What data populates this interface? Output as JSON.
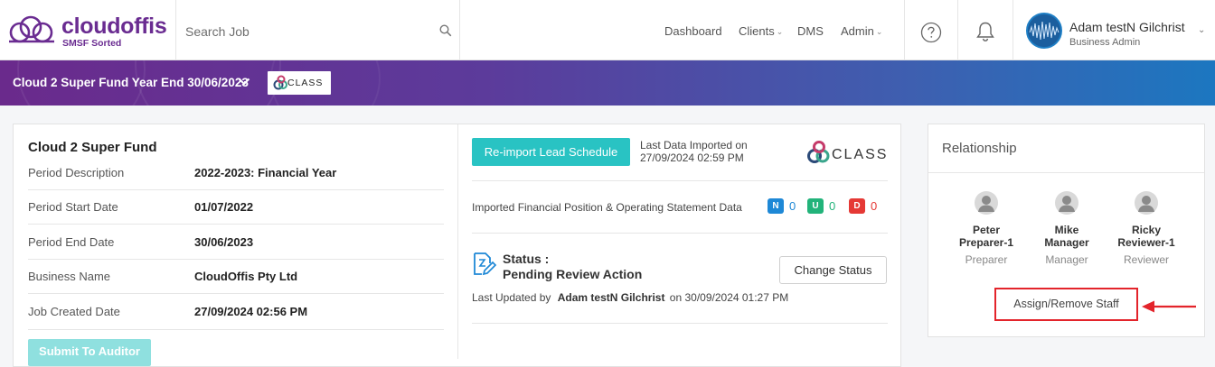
{
  "brand": {
    "name": "cloudoffis",
    "tagline": "SMSF Sorted",
    "color": "#6a2c91"
  },
  "search": {
    "placeholder": "Search Job",
    "icon": "search-icon"
  },
  "nav": {
    "dashboard": "Dashboard",
    "clients": "Clients",
    "dms": "DMS",
    "admin": "Admin"
  },
  "header_icons": {
    "help": "help-icon",
    "notifications": "bell-icon"
  },
  "user": {
    "name": "Adam testN Gilchrist",
    "role": "Business Admin"
  },
  "job_bar": {
    "title": "Cloud 2 Super Fund Year End 30/06/2023",
    "logo_text": "CLASS",
    "gradient": [
      "#6a2a8c",
      "#1c77c0"
    ]
  },
  "fund": {
    "name": "Cloud 2 Super Fund",
    "rows": [
      {
        "label": "Period Description",
        "value": "2022-2023: Financial Year"
      },
      {
        "label": "Period Start Date",
        "value": "01/07/2022"
      },
      {
        "label": "Period End Date",
        "value": "30/06/2023"
      },
      {
        "label": "Business Name",
        "value": "CloudOffis Pty Ltd"
      },
      {
        "label": "Job Created Date",
        "value": "27/09/2024 02:56 PM"
      }
    ],
    "submit_label": "Submit To Auditor"
  },
  "import": {
    "button_label": "Re-import Lead Schedule",
    "last_imported_label": "Last Data Imported on",
    "last_imported_value": "27/09/2024 02:59 PM",
    "logo_text": "CLASS",
    "data_label": "Imported Financial Position & Operating Statement Data",
    "badges": [
      {
        "letter": "N",
        "count": "0",
        "color": "#1e88d6"
      },
      {
        "letter": "U",
        "count": "0",
        "color": "#22b37a"
      },
      {
        "letter": "D",
        "count": "0",
        "color": "#e53935"
      }
    ]
  },
  "status": {
    "label": "Status :",
    "value": "Pending Review Action",
    "change_label": "Change Status",
    "updated_prefix": "Last Updated by",
    "updated_by": "Adam testN Gilchrist",
    "updated_on": "on 30/09/2024 01:27 PM",
    "accent": "#29c3c3"
  },
  "relationship": {
    "title": "Relationship",
    "staff": [
      {
        "first": "Peter",
        "last": "Preparer-1",
        "role": "Preparer"
      },
      {
        "first": "Mike",
        "last": "Manager",
        "role": "Manager"
      },
      {
        "first": "Ricky",
        "last": "Reviewer-1",
        "role": "Reviewer"
      }
    ],
    "assign_label": "Assign/Remove Staff",
    "highlight_color": "#e3242b"
  }
}
